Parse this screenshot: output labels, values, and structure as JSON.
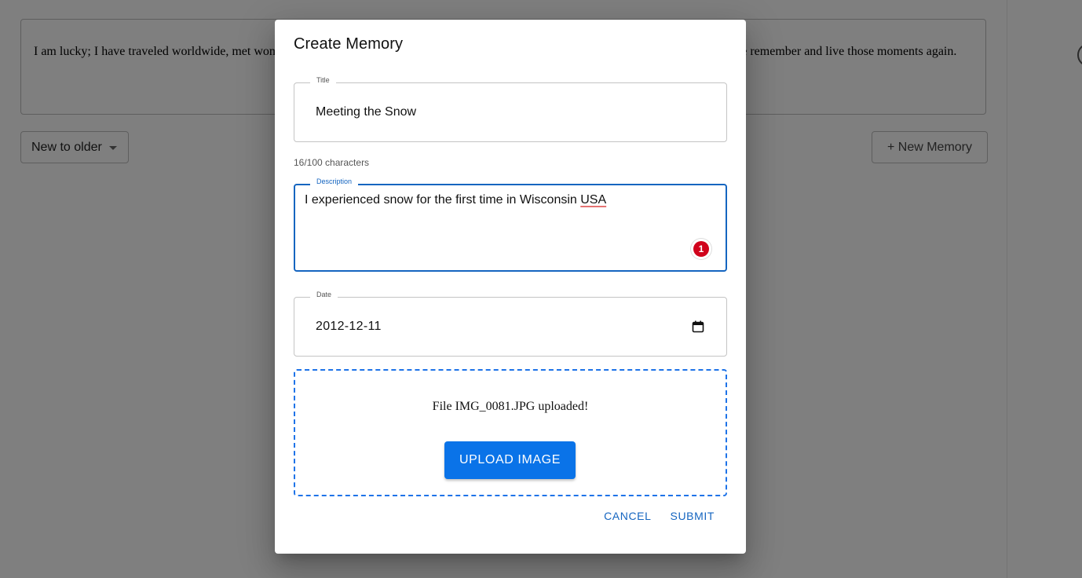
{
  "background": {
    "intro_text": "I am lucky; I have traveled worldwide, met wonderful people, and lived great moments. I love to document them. This memory lane helps me remember and live those moments again.",
    "sort_value": "New to older",
    "new_memory_label": "+ New Memory"
  },
  "dialog": {
    "title": "Create Memory",
    "title_field": {
      "label": "Title",
      "value": "Meeting the Snow"
    },
    "char_count": "16/100 characters",
    "description_field": {
      "label": "Description",
      "value_before": "I experienced snow for the first time in Wisconsin ",
      "value_flagged": "USA",
      "issue_count": "1"
    },
    "date_field": {
      "label": "Date",
      "value": "2012-12-11"
    },
    "upload": {
      "status": "File IMG_0081.JPG uploaded!",
      "button_label": "UPLOAD IMAGE"
    },
    "actions": {
      "cancel": "CANCEL",
      "submit": "SUBMIT"
    }
  },
  "colors": {
    "accent": "#1565c0",
    "upload_button": "#0a73e8",
    "badge": "#d0021b"
  },
  "icons": [
    "chevron-down-icon",
    "calendar-icon",
    "grammar-badge-icon"
  ]
}
